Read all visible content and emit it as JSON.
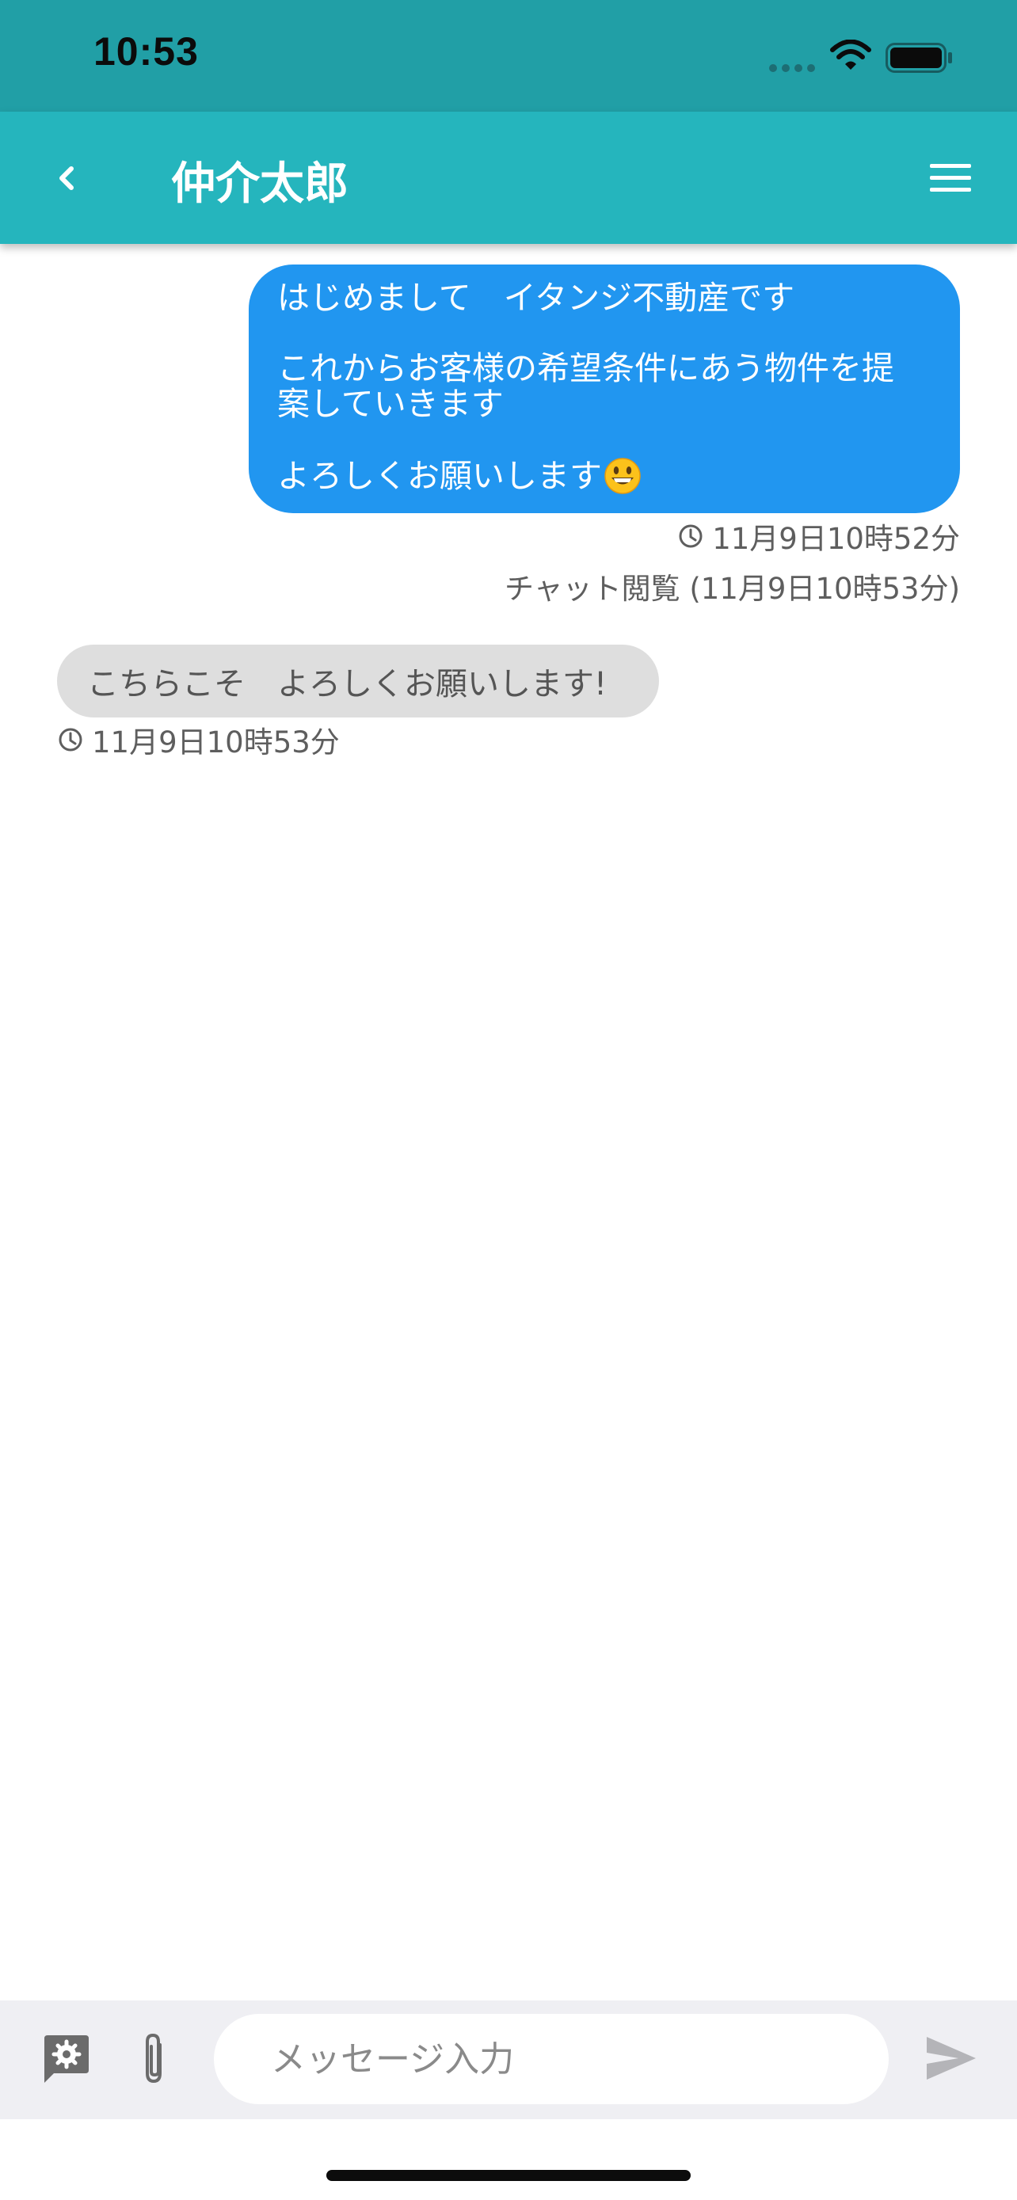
{
  "status_bar": {
    "time": "10:53"
  },
  "header": {
    "title": "仲介太郎"
  },
  "messages": {
    "sent": {
      "lines": [
        "はじめまして　イタンジ不動産です",
        "これからお客様の希望条件にあう物件を提",
        "案していきます",
        "よろしくお願いします"
      ],
      "emoji": "grinning-face-emoji",
      "timestamp": "11月9日10時52分",
      "read_status": "チャット閲覧 (11月9日10時53分)"
    },
    "received": {
      "text": "こちらこそ　よろしくお願いします!",
      "timestamp": "11月9日10時53分"
    }
  },
  "composer": {
    "placeholder": "メッセージ入力"
  },
  "colors": {
    "status_bar": "#219fa6",
    "app_bar": "#25b5bd",
    "sent_bubble": "#2196f0",
    "received_bubble": "#dedede",
    "composer_bar": "#efeff3"
  }
}
